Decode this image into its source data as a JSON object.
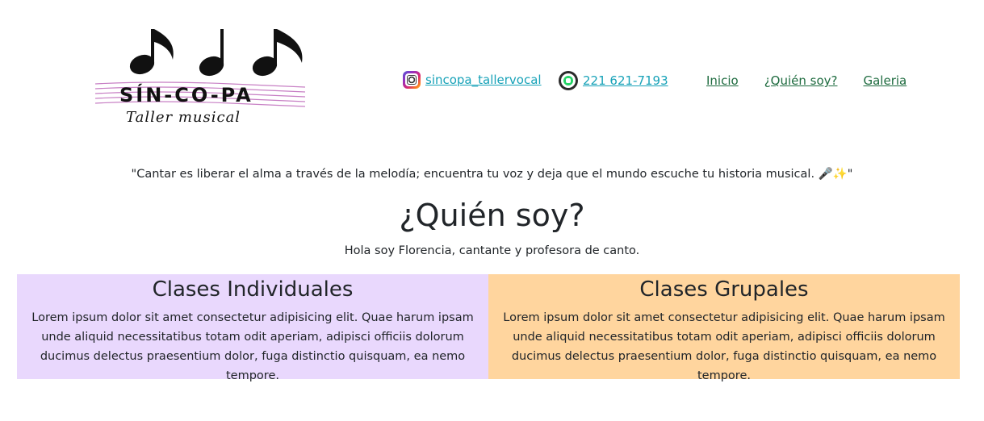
{
  "logo": {
    "name": "SÍN-CO-PA",
    "subtitle": "Taller musical"
  },
  "contacts": {
    "instagram": {
      "icon": "instagram-icon",
      "handle": "sincopa_tallervocal"
    },
    "whatsapp": {
      "icon": "whatsapp-icon",
      "phone": "221 621-7193"
    }
  },
  "nav": {
    "items": [
      {
        "label": "Inicio"
      },
      {
        "label": "¿Quién soy?"
      },
      {
        "label": "Galeria"
      }
    ]
  },
  "quote": "\"Cantar es liberar el alma a través de la melodía; encuentra tu voz y deja que el mundo escuche tu historia musical. 🎤✨\"",
  "about": {
    "title": "¿Quién soy?",
    "intro": "Hola soy Florencia, cantante y profesora de canto."
  },
  "cards": [
    {
      "title": "Clases Individuales",
      "text": "Lorem ipsum dolor sit amet consectetur adipisicing elit. Quae harum ipsam unde aliquid necessitatibus totam odit aperiam, adipisci officiis dolorum ducimus delectus praesentium dolor, fuga distinctio quisquam, ea nemo tempore.",
      "color": "#e9d8fd"
    },
    {
      "title": "Clases Grupales",
      "text": "Lorem ipsum dolor sit amet consectetur adipisicing elit. Quae harum ipsam unde aliquid necessitatibus totam odit aperiam, adipisci officiis dolorum ducimus delectus praesentium dolor, fuga distinctio quisquam, ea nemo tempore.",
      "color": "#ffd59e"
    }
  ],
  "colors": {
    "link": "#17a2b8",
    "nav_link": "#1e6b3f",
    "text": "#212529"
  }
}
